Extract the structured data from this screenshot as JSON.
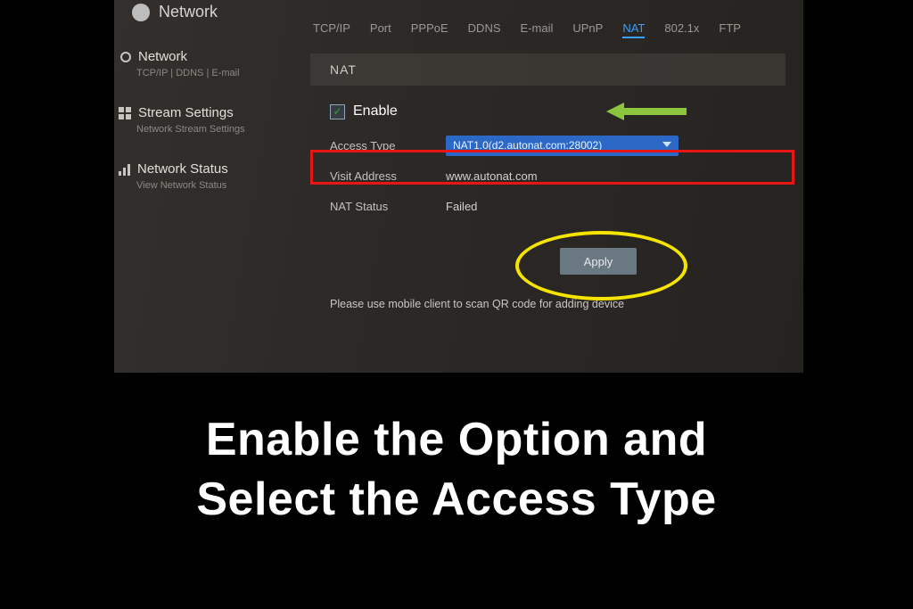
{
  "header": {
    "title": "Network"
  },
  "sidebar": {
    "items": [
      {
        "label": "Network",
        "sub": "TCP/IP | DDNS | E-mail"
      },
      {
        "label": "Stream Settings",
        "sub": "Network Stream Settings"
      },
      {
        "label": "Network Status",
        "sub": "View Network Status"
      }
    ]
  },
  "tabs": [
    "TCP/IP",
    "Port",
    "PPPoE",
    "DDNS",
    "E-mail",
    "UPnP",
    "NAT",
    "802.1x",
    "FTP"
  ],
  "active_tab": "NAT",
  "section": {
    "title": "NAT",
    "enable_label": "Enable",
    "enable_checked": true,
    "rows": {
      "access_type": {
        "label": "Access Type",
        "value": "NAT1.0(d2.autonat.com:28002)"
      },
      "visit_address": {
        "label": "Visit Address",
        "value": "www.autonat.com"
      },
      "nat_status": {
        "label": "NAT Status",
        "value": "Failed"
      }
    },
    "apply_label": "Apply",
    "qr_msg": "Please use mobile client to scan QR code for adding device"
  },
  "annotations": {
    "arrow_color": "#8cc63f",
    "highlight_box_color": "#e81515",
    "ellipse_color": "#f5e400"
  },
  "caption_line1": "Enable the Option and",
  "caption_line2": "Select the Access Type"
}
